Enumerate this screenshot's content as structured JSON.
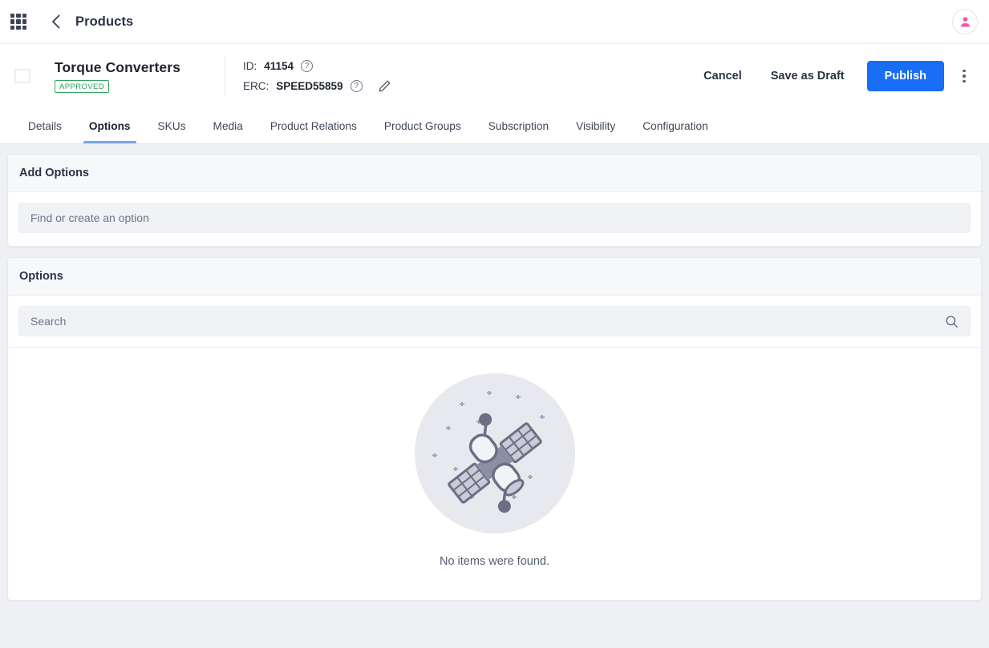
{
  "topbar": {
    "apps_icon": "grid-apps-icon",
    "back_icon": "chevron-left-icon",
    "title": "Products",
    "avatar_icon": "user-avatar-icon"
  },
  "product_header": {
    "thumbnail_icon": "image-placeholder-icon",
    "name": "Torque Converters",
    "status_badge": "APPROVED",
    "id_label": "ID:",
    "id_value": "41154",
    "erc_label": "ERC:",
    "erc_value": "SPEED55859",
    "help_icon": "question-mark-icon",
    "edit_icon": "pencil-icon",
    "kebab_icon": "more-vertical-icon",
    "actions": {
      "cancel": "Cancel",
      "save_draft": "Save as Draft",
      "publish": "Publish",
      "publish_color": "#1a6ef5"
    }
  },
  "tabs": [
    {
      "label": "Details",
      "active": false
    },
    {
      "label": "Options",
      "active": true
    },
    {
      "label": "SKUs",
      "active": false
    },
    {
      "label": "Media",
      "active": false
    },
    {
      "label": "Product Relations",
      "active": false
    },
    {
      "label": "Product Groups",
      "active": false
    },
    {
      "label": "Subscription",
      "active": false
    },
    {
      "label": "Visibility",
      "active": false
    },
    {
      "label": "Configuration",
      "active": false
    }
  ],
  "add_options_card": {
    "title": "Add Options",
    "input_placeholder": "Find or create an option",
    "input_value": ""
  },
  "options_card": {
    "title": "Options",
    "search_placeholder": "Search",
    "search_value": "",
    "search_icon": "search-icon",
    "empty_state": {
      "illustration": "satellite-in-space-icon",
      "message": "No items were found."
    }
  },
  "colors": {
    "page_background": "#eef0f4",
    "card_background": "#ffffff",
    "card_header": "#f7f8f9",
    "accent_blue": "#1a6ef5",
    "tab_underline": "#78a4ef",
    "badge_green": "#2c9b5b",
    "input_background": "#f0f2f6",
    "avatar_pink": "#f655a8",
    "illustration_gray": "#6b6e85"
  }
}
